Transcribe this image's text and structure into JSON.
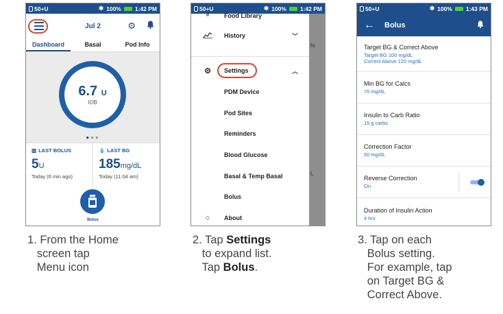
{
  "status": {
    "signal": "50+U",
    "battery": "100%",
    "time1": "1:42 PM",
    "time2": "1:42 PM",
    "time3": "1:43 PM"
  },
  "home": {
    "date": "Jul 2",
    "tabs": [
      "Dashboard",
      "Basal",
      "Pod Info"
    ],
    "iob_value": "6.7",
    "iob_unit": "U",
    "iob_label": "IOB",
    "last_bolus_label": "LAST BOLUS",
    "last_bolus_value": "5",
    "last_bolus_unit": "U",
    "last_bolus_time": "Today (6 min ago)",
    "last_bg_label": "LAST BG",
    "last_bg_value": "185",
    "last_bg_unit": "mg/dL",
    "last_bg_time": "Today (11:04 am)",
    "bolus_button": "Bolus"
  },
  "menu": {
    "food_library": "Food Library",
    "history": "History",
    "settings": "Settings",
    "sub_items": [
      "PDM Device",
      "Pod Sites",
      "Reminders",
      "Blood Glucose",
      "Basal & Temp Basal",
      "Bolus"
    ],
    "about": "About",
    "shade_fo": "fo",
    "shade_l": "L"
  },
  "bolus_settings": {
    "title": "Bolus",
    "items": [
      {
        "name": "Target BG & Correct Above",
        "value": "Target BG 100 mg/dL",
        "value2": "Correct Above 120 mg/dL"
      },
      {
        "name": "Min BG for Calcs",
        "value": "70 mg/dL"
      },
      {
        "name": "Insulin to Carb Ratio",
        "value": "15 g carbs"
      },
      {
        "name": "Correction Factor",
        "value": "50 mg/dL"
      },
      {
        "name": "Reverse Correction",
        "value": "On",
        "toggle_on": true
      },
      {
        "name": "Duration of Insulin Action",
        "value": "4 hrs"
      }
    ]
  },
  "captions": {
    "c1_line1": "1. From the Home",
    "c1_line2": "screen tap",
    "c1_line3": "Menu icon",
    "c2_line1_a": "2. Tap ",
    "c2_line1_b": "Settings",
    "c2_line2": "to expand list.",
    "c2_line3_a": "Tap ",
    "c2_line3_b": "Bolus",
    "c2_line3_c": ".",
    "c3_line1": "3. Tap on each",
    "c3_line2": "Bolus setting.",
    "c3_line3": "For example, tap",
    "c3_line4": "on Target BG &",
    "c3_line5": "Correct Above."
  },
  "colors": {
    "brand_blue": "#1e4f8c",
    "highlight_red": "#d9442f",
    "value_blue": "#1e6fc0"
  }
}
